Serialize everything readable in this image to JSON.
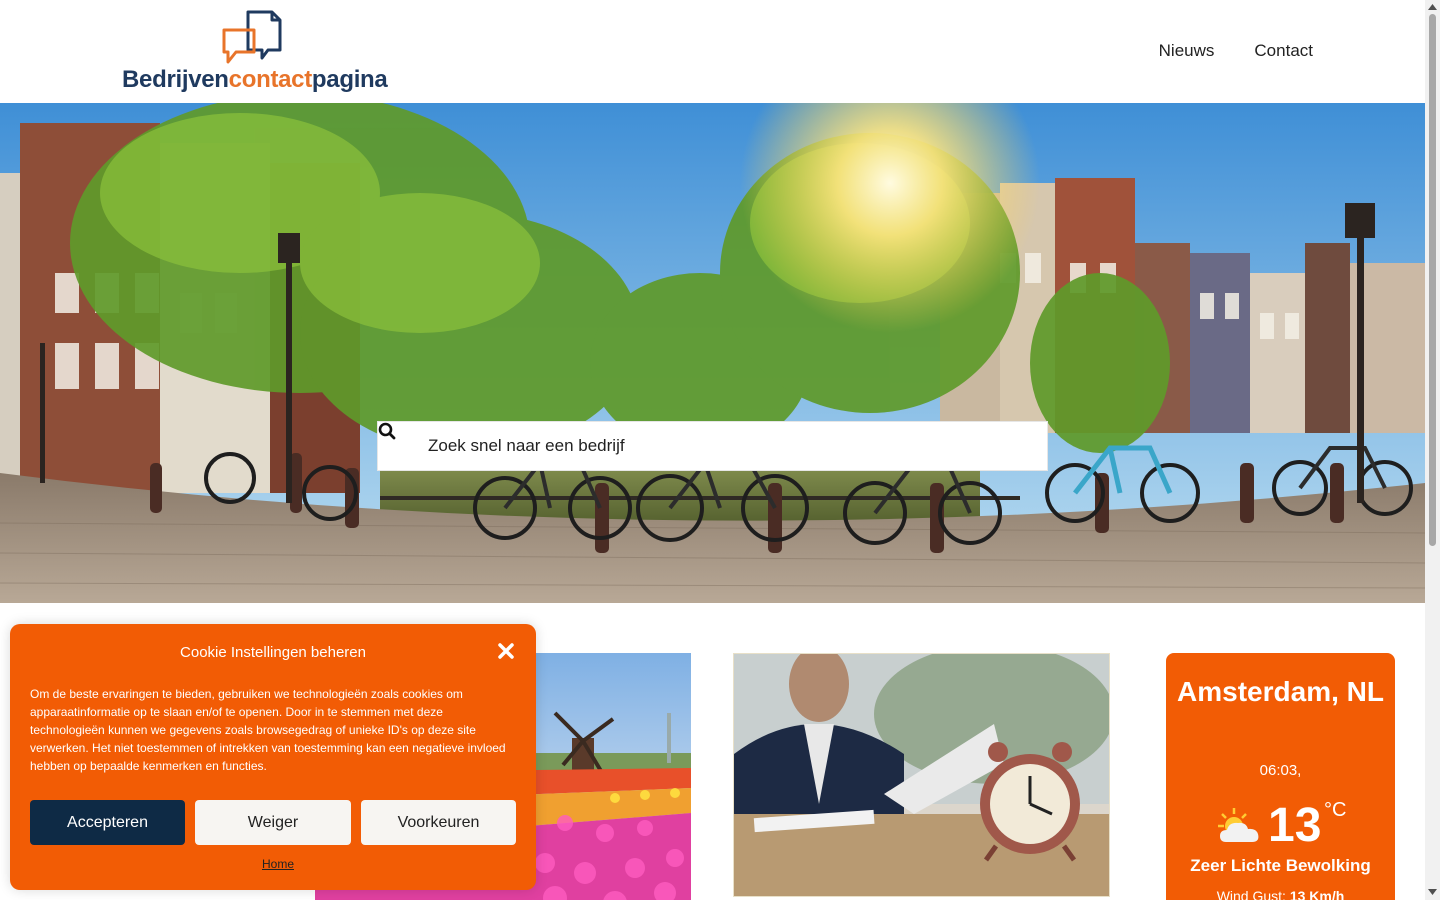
{
  "header": {
    "logo_part1": "Bedrijven",
    "logo_part2": "contact",
    "logo_part3": "pagina",
    "logo_icon": "speech-bubbles-icon",
    "nav": [
      {
        "label": "Nieuws"
      },
      {
        "label": "Contact"
      }
    ]
  },
  "hero": {
    "search": {
      "placeholder": "Zoek snel naar een bedrijf",
      "icon": "search-icon"
    }
  },
  "weather": {
    "city": "Amsterdam, NL",
    "time": "06:03,",
    "temperature": "13",
    "unit": "°C",
    "condition_icon": "cloud-sun-icon",
    "description": "Zeer Lichte Bewolking",
    "wind_label": "Wind Gust:",
    "wind_value": "13 Km/h"
  },
  "cookie": {
    "title": "Cookie Instellingen beheren",
    "text": "Om de beste ervaringen te bieden, gebruiken we technologieën zoals cookies om apparaatinformatie op te slaan en/of te openen. Door in te stemmen met deze technologieën kunnen we gegevens zoals browsegedrag of unieke ID's op deze site verwerken. Het niet toestemmen of intrekken van toestemming kan een negatieve invloed hebben op bepaalde kenmerken en functies.",
    "accept_label": "Accepteren",
    "deny_label": "Weiger",
    "prefs_label": "Voorkeuren",
    "home_link": "Home"
  },
  "colors": {
    "brand_orange": "#f25c05",
    "brand_navy": "#0e2a45",
    "logo_blue": "#1f3a5f",
    "logo_orange": "#e8742a"
  }
}
